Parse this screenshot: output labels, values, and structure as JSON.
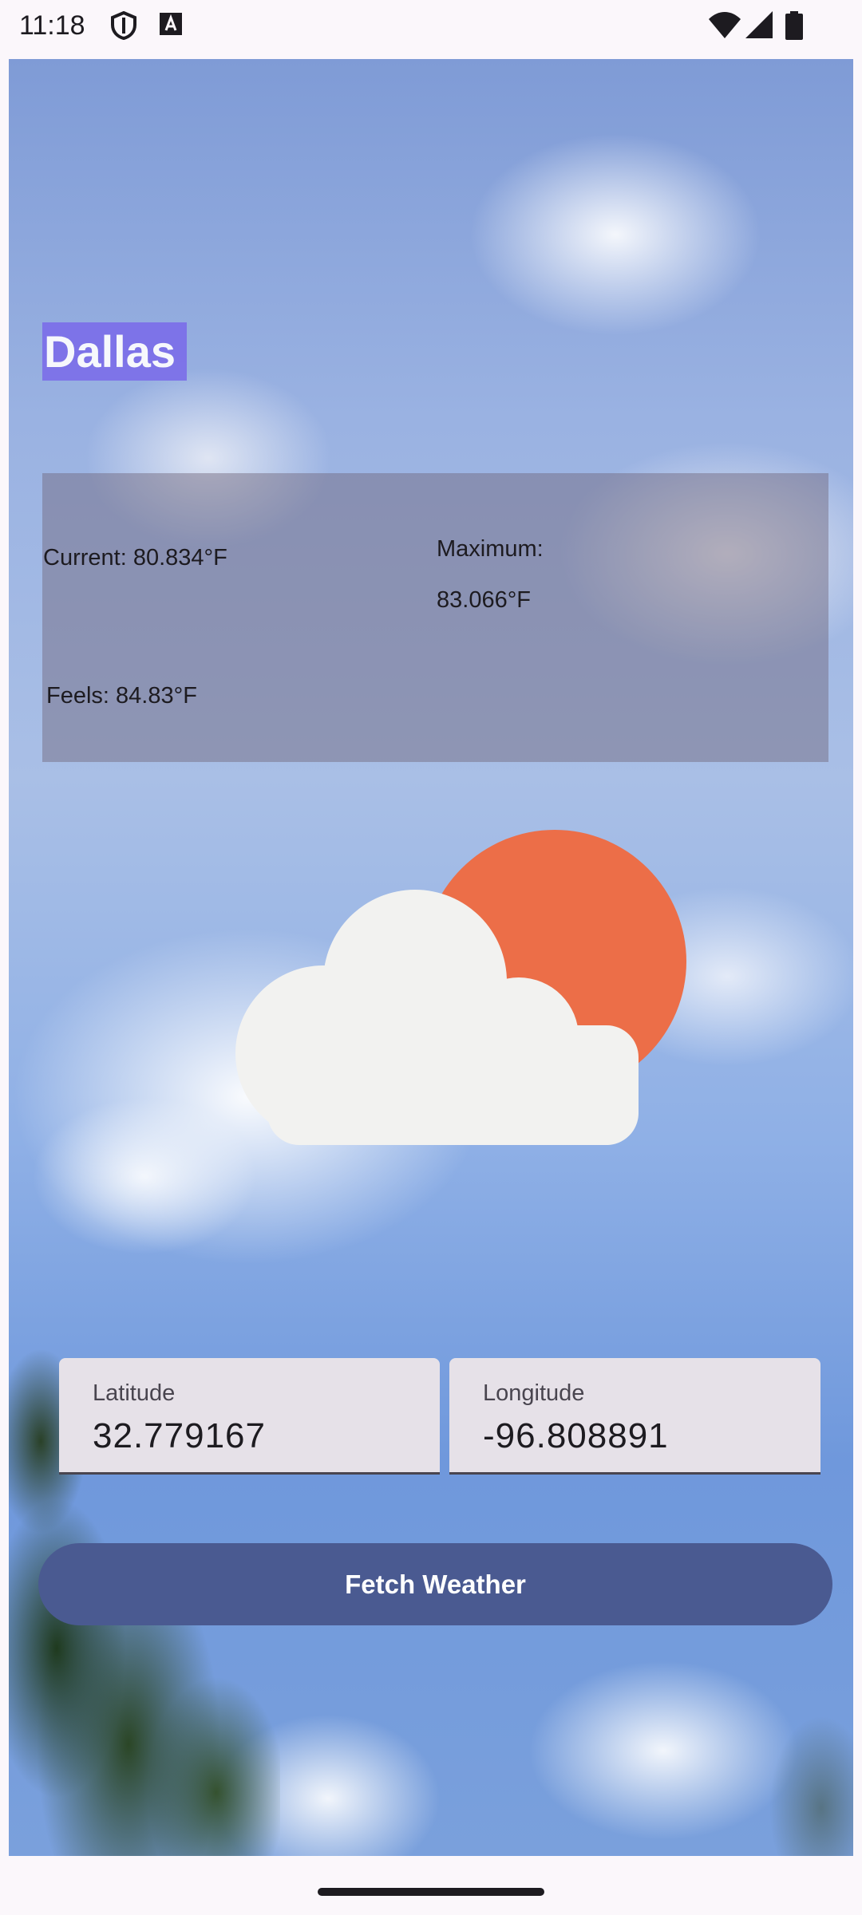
{
  "status_bar": {
    "time": "11:18",
    "icons": [
      "shield-icon",
      "keyboard-a-icon",
      "wifi-icon",
      "signal-icon",
      "battery-icon"
    ]
  },
  "city": {
    "name": "Dallas"
  },
  "weather": {
    "current": "Current: 80.834°F",
    "maximum_label": "Maximum:",
    "maximum_value": "83.066°F",
    "feels": "Feels: 84.83°F",
    "icon": "partly-cloudy-icon"
  },
  "inputs": {
    "latitude": {
      "label": "Latitude",
      "value": "32.779167"
    },
    "longitude": {
      "label": "Longitude",
      "value": "-96.808891"
    }
  },
  "actions": {
    "fetch_label": "Fetch Weather"
  },
  "colors": {
    "city_badge": "#7c6fe9",
    "button": "#4a5a91",
    "sun": "#ec6e48",
    "cloud": "#f2f2f0",
    "field_bg": "#e6e1e8"
  }
}
